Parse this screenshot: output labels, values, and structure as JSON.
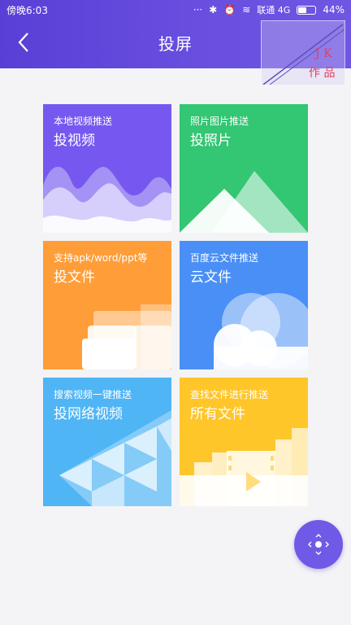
{
  "status_bar": {
    "time": "傍晚6:03",
    "carrier": "联通 4G",
    "battery": "44%"
  },
  "header": {
    "title": "投屏",
    "watermark_text": "JK 作品"
  },
  "tiles": [
    {
      "subtitle": "本地视频推送",
      "title": "投视频",
      "color": "#7658f0",
      "icon": "waves-art"
    },
    {
      "subtitle": "照片图片推送",
      "title": "投照片",
      "color": "#33c673",
      "icon": "mountains-art"
    },
    {
      "subtitle": "支持apk/word/ppt等",
      "title": "投文件",
      "color": "#ff9d38",
      "icon": "folder-art"
    },
    {
      "subtitle": "百度云文件推送",
      "title": "云文件",
      "color": "#4a8ff5",
      "icon": "cloud-art"
    },
    {
      "subtitle": "搜索视频一键推送",
      "title": "投网络视频",
      "color": "#4fb5f5",
      "icon": "triangle-pattern-art"
    },
    {
      "subtitle": "查找文件进行推送",
      "title": "所有文件",
      "color": "#ffc62a",
      "icon": "film-strip-art"
    }
  ],
  "fab": {
    "icon": "direction-pad-icon"
  }
}
